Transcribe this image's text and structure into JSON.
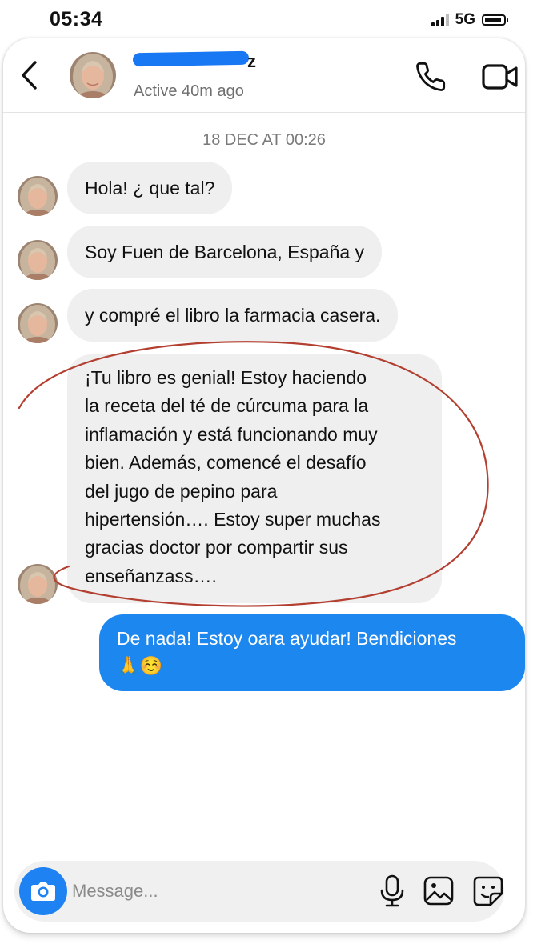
{
  "status_bar": {
    "time": "05:34",
    "network": "5G"
  },
  "header": {
    "contact_name_visible_suffix": "z",
    "presence": "Active 40m ago",
    "icons": {
      "back": "chevron-left-icon",
      "call": "phone-icon",
      "video": "video-camera-icon"
    }
  },
  "conversation": {
    "date_separator": "18 DEC AT 00:26",
    "incoming": [
      "Hola! ¿ que tal?",
      "Soy Fuen de Barcelona, España y",
      "y compré el libro la farmacia casera."
    ],
    "long_message_lines": [
      "¡Tu libro es genial! Estoy haciendo",
      "la receta del té de cúrcuma para la",
      "inflamación y está funcionando muy",
      "bien. Además, comencé el desafío",
      "del jugo de pepino para",
      "hipertensión…. Estoy super muchas",
      "gracias doctor por compartir sus",
      "enseñanzass…."
    ],
    "outgoing_lines": [
      "De nada! Estoy oara ayudar! Bendiciones",
      "🙏☺️"
    ]
  },
  "composer": {
    "placeholder": "Message...",
    "icons": [
      "camera-icon",
      "microphone-icon",
      "gallery-icon",
      "sticker-icon"
    ]
  },
  "colors": {
    "outgoing_bubble": "#1d87f0",
    "incoming_bubble": "#efefef",
    "camera_button": "#1f82f3",
    "name_redaction": "#1877f2",
    "annotation_stroke": "#b33f30"
  }
}
